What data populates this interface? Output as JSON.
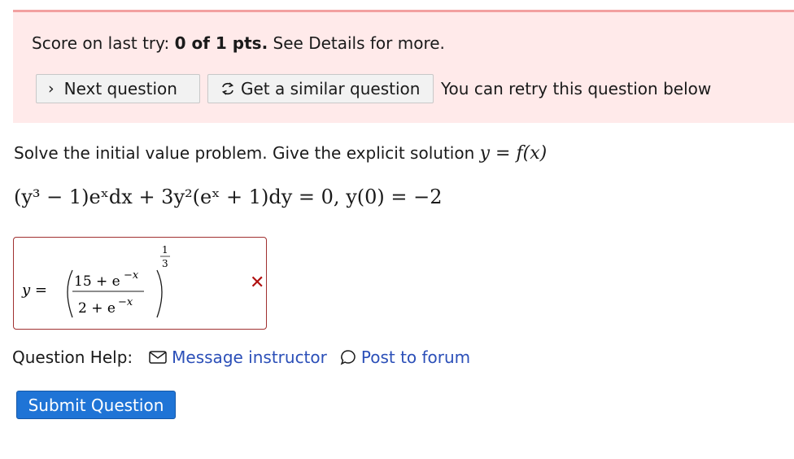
{
  "score": {
    "prefix": "Score on last try: ",
    "value": "0 of 1 pts.",
    "suffix": " See Details for more."
  },
  "buttons": {
    "next_chevron": "›",
    "next_label": "Next question",
    "similar_label": "Get a similar question",
    "retry_text": "You can retry this question below"
  },
  "question": {
    "prompt": "Solve the initial value problem. Give the explicit solution ",
    "prompt_math": "y = f(x)",
    "equation": "(y³ − 1)eˣdx + 3y²(eˣ + 1)dy = 0, y(0) = −2"
  },
  "answer": {
    "lhs": "y =",
    "numerator": "15 + e",
    "numerator_exp": "−x",
    "denominator": "2 + e",
    "denominator_exp": "−x",
    "outer_exp_num": "1",
    "outer_exp_den": "3",
    "status_mark": "✕",
    "status_color": "#b01010"
  },
  "help": {
    "label": "Question Help:",
    "message_label": "Message instructor",
    "forum_label": "Post to forum",
    "message_icon": "envelope-icon",
    "forum_icon": "speech-bubble-icon"
  },
  "submit": {
    "label": "Submit Question",
    "color": "#1f74d6"
  }
}
